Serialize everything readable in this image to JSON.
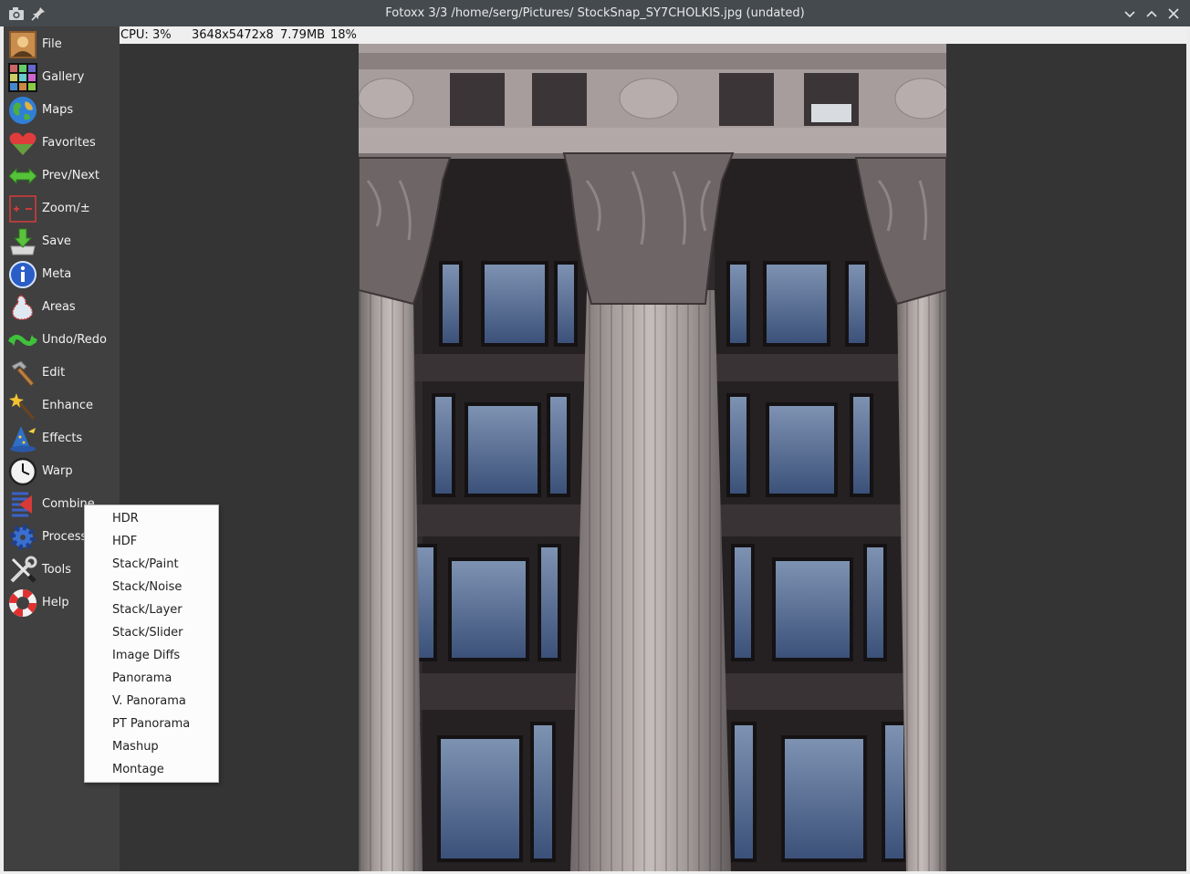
{
  "window": {
    "title": "Fotoxx 3/3 /home/serg/Pictures/ StockSnap_SY7CHOLKIS.jpg (undated)",
    "icons": [
      "camera-icon",
      "pin-icon"
    ],
    "controls": [
      "minimize-chevron-icon",
      "maximize-chevron-icon",
      "close-icon"
    ]
  },
  "status": {
    "cpu": "CPU: 3%",
    "dimensions": "3648x5472x8",
    "size": "7.79MB",
    "zoom": "18%"
  },
  "sidebar": {
    "items": [
      {
        "label": "File",
        "icon": "portrait-icon"
      },
      {
        "label": "Gallery",
        "icon": "thumbnail-grid-icon"
      },
      {
        "label": "Maps",
        "icon": "globe-icon"
      },
      {
        "label": "Favorites",
        "icon": "heart-icon"
      },
      {
        "label": "Prev/Next",
        "icon": "double-arrow-icon"
      },
      {
        "label": "Zoom/±",
        "icon": "zoom-plus-minus-icon"
      },
      {
        "label": "Save",
        "icon": "save-arrow-icon"
      },
      {
        "label": "Meta",
        "icon": "info-icon"
      },
      {
        "label": "Areas",
        "icon": "area-blob-icon"
      },
      {
        "label": "Undo/Redo",
        "icon": "undo-redo-arrows-icon"
      },
      {
        "label": "Edit",
        "icon": "hammer-icon"
      },
      {
        "label": "Enhance",
        "icon": "magic-wand-icon"
      },
      {
        "label": "Effects",
        "icon": "wizard-hat-icon"
      },
      {
        "label": "Warp",
        "icon": "clock-icon"
      },
      {
        "label": "Combine",
        "icon": "combine-arrow-icon"
      },
      {
        "label": "Process",
        "icon": "gear-icon"
      },
      {
        "label": "Tools",
        "icon": "wrench-screwdriver-icon"
      },
      {
        "label": "Help",
        "icon": "lifebuoy-icon"
      }
    ]
  },
  "combine_menu": {
    "items": [
      "HDR",
      "HDF",
      "Stack/Paint",
      "Stack/Noise",
      "Stack/Layer",
      "Stack/Slider",
      "Image Diffs",
      "Panorama",
      "V. Panorama",
      "PT Panorama",
      "Mashup",
      "Montage"
    ]
  },
  "colors": {
    "titlebar": "#454a4f",
    "sidebar": "#404040",
    "canvas": "#343434",
    "menu": "#fcfcfc"
  }
}
